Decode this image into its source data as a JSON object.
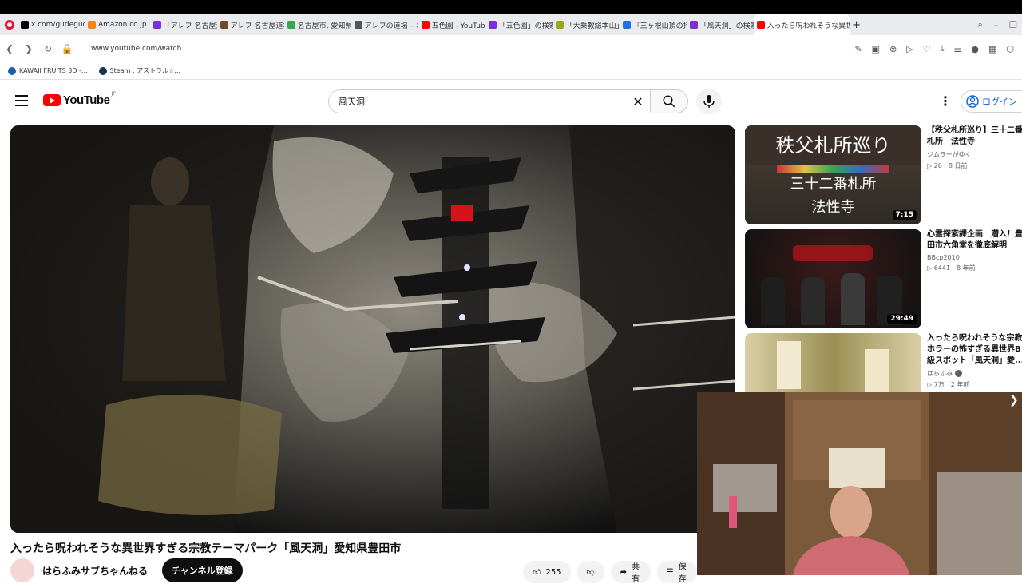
{
  "browser": {
    "tabs": [
      {
        "label": "x.com/gudegude",
        "color": "#000000"
      },
      {
        "label": "Amazon.co.jp",
        "color": "#f2841a"
      },
      {
        "label": "「アレフ 名古屋道場",
        "color": "#7b2fd6"
      },
      {
        "label": "アレフ 名古屋道場",
        "color": "#6f4b2c"
      },
      {
        "label": "名古屋市, 愛知県",
        "color": "#34a853"
      },
      {
        "label": "アレフの道場 – オウ",
        "color": "#555555"
      },
      {
        "label": "五色園 - YouTube",
        "color": "#ff0000"
      },
      {
        "label": "「五色園」の検索結",
        "color": "#7b2fd6"
      },
      {
        "label": "「大乗教総本山」の",
        "color": "#9aa61f"
      },
      {
        "label": "『三ヶ根山頂の拷問",
        "color": "#1a73e8"
      },
      {
        "label": "「風天洞」の検索結",
        "color": "#7b2fd6"
      },
      {
        "label": "入ったら呪われそうな異世",
        "color": "#ff0000",
        "active": true
      }
    ],
    "url": "www.youtube.com/watch",
    "bookmarks": [
      {
        "label": "KAWAII FRUITS 3D -..."
      },
      {
        "label": "Steam : アストラル☆..."
      }
    ]
  },
  "youtube": {
    "logo_text": "YouTube",
    "logo_region": "JP",
    "search_value": "風天洞",
    "login_label": "ログイン"
  },
  "video": {
    "title": "入ったら呪われそうな異世界すぎる宗教テーマパーク「風天洞」愛知県豊田市",
    "channel": "はらふみサブちゃんねる",
    "subscribe_label": "チャンネル登録",
    "likes": "255",
    "share_label": "共有",
    "save_label": "保存"
  },
  "recommendations": [
    {
      "title": "【秩父札所巡り】三十二番札所　法性寺",
      "channel": "ジムラーがゆく",
      "meta": "▷ 26　8 日前",
      "duration": "7:15",
      "thumb_text_top": "秩父札所巡り",
      "thumb_text_mid": "三十二番札所",
      "thumb_text_bot": "法性寺"
    },
    {
      "title": "心霊探索課企画　潜入！豊田市六角堂を徹底解明",
      "channel": "BBcp2010",
      "meta": "▷ 6441　8 年前",
      "duration": "29:49"
    },
    {
      "title": "入ったら呪われそうな宗教ホラーの怖すぎる異世界B級スポット「風天洞」愛...",
      "channel": "はらふみ",
      "meta": "▷ 7万　2 年前",
      "duration": ""
    }
  ],
  "colors": {
    "accent": "#ff0000",
    "link": "#065fd4"
  }
}
